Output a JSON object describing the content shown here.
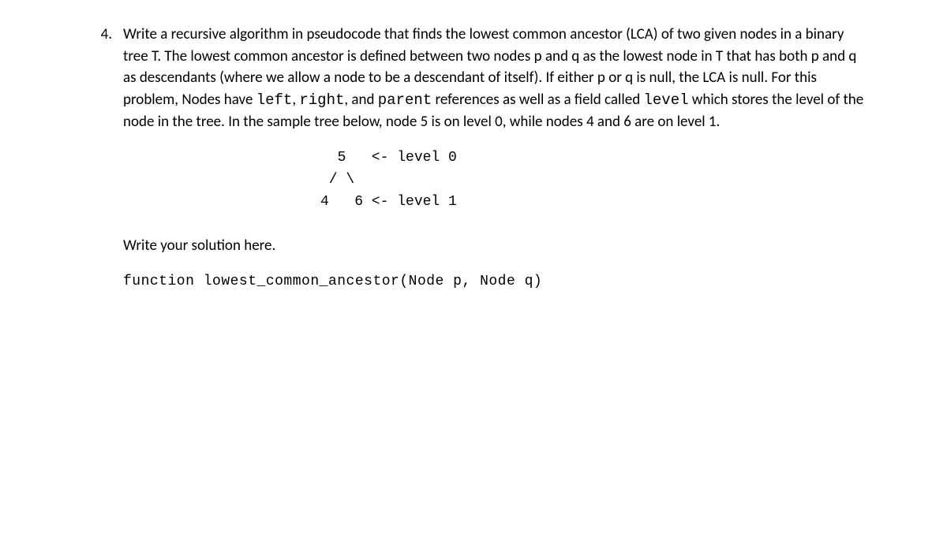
{
  "question": {
    "number": "4.",
    "text_part1": "Write a recursive algorithm in pseudocode that finds the lowest common ancestor (LCA) of two given nodes in a binary tree T. The lowest common ancestor is defined between two nodes p and q as the lowest node in T that has both p and q as descendants (where we allow a node to be a descendant of itself). If either p or q is null, the LCA is null. For this problem, Nodes have ",
    "code1": "left",
    "text_part2": ", ",
    "code2": "right",
    "text_part3": ", and ",
    "code3": "parent",
    "text_part4": " references as well as a field called ",
    "code4": "level",
    "text_part5": " which stores the level of the node in the tree. In the sample tree below, node 5 is on level 0, while nodes 4 and 6 are on level 1."
  },
  "tree": {
    "diagram": "  5   <- level 0\n / \\\n4   6 <- level 1"
  },
  "solution_prompt": "Write your solution here.",
  "function_signature": "function lowest_common_ancestor(Node p, Node q)"
}
